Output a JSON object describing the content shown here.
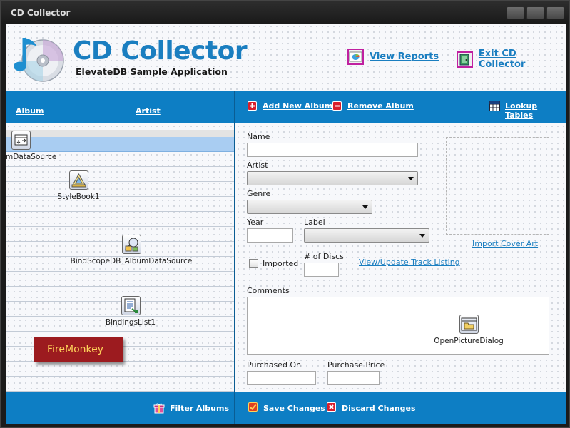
{
  "window": {
    "title": "CD Collector"
  },
  "header": {
    "app_title": "CD Collector",
    "app_subtitle": "ElevateDB Sample Application",
    "view_reports": "View Reports",
    "exit": "Exit CD Collector"
  },
  "grid": {
    "columns": [
      "Album",
      "Artist"
    ],
    "filter_label": "Filter Albums"
  },
  "toolbar": {
    "add_album": "Add New Album",
    "remove_album": "Remove Album",
    "lookup_tables": "Lookup Tables"
  },
  "form": {
    "name_label": "Name",
    "name_value": "",
    "artist_label": "Artist",
    "artist_value": "",
    "genre_label": "Genre",
    "genre_value": "",
    "year_label": "Year",
    "year_value": "",
    "label_label": "Label",
    "label_value": "",
    "imported_label": "Imported",
    "imported_checked": false,
    "discs_label": "# of Discs",
    "discs_value": "",
    "track_link": "View/Update Track Listing",
    "cover_link": "Import Cover Art",
    "comments_label": "Comments",
    "comments_value": "",
    "purchased_on_label": "Purchased On",
    "purchased_on_value": "",
    "purchase_price_label": "Purchase Price",
    "purchase_price_value": ""
  },
  "footer": {
    "save": "Save Changes",
    "discard": "Discard Changes"
  },
  "components": {
    "datasource": "mDataSource",
    "stylebook": "StyleBook1",
    "bindscope": "BindScopeDB_AlbumDataSource",
    "bindingslist": "BindingsList1",
    "openpicture": "OpenPictureDialog"
  },
  "badge": {
    "text": "FireMonkey"
  },
  "colors": {
    "accent_blue": "#0d7ec4",
    "title_blue": "#1a7ec0",
    "badge_red": "#9c1b1f",
    "badge_text": "#ffd35a"
  }
}
